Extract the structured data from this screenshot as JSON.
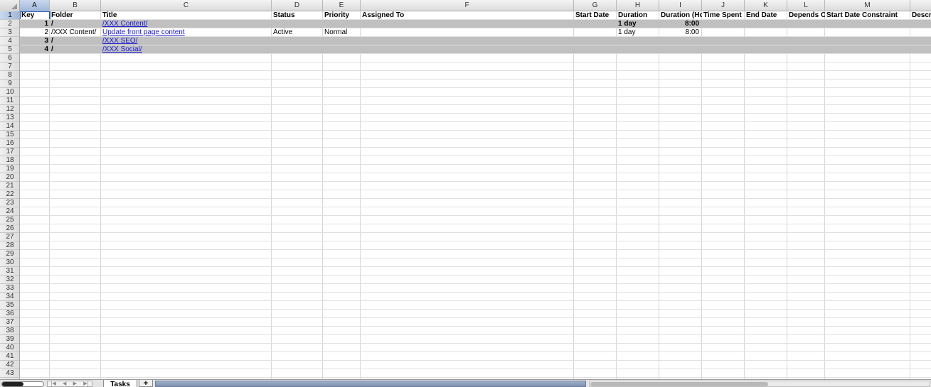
{
  "columns": [
    "A",
    "B",
    "C",
    "D",
    "E",
    "F",
    "G",
    "H",
    "I",
    "J",
    "K",
    "L",
    "M"
  ],
  "selected_column": "A",
  "rows": [
    "1",
    "2",
    "3",
    "4",
    "5",
    "6",
    "7",
    "8",
    "9",
    "10",
    "11",
    "12",
    "13",
    "14",
    "15",
    "16",
    "17",
    "18",
    "19",
    "20",
    "21",
    "22",
    "23",
    "24",
    "25",
    "26",
    "27",
    "28",
    "29",
    "30",
    "31",
    "32",
    "33",
    "34",
    "35",
    "36",
    "37",
    "38",
    "39",
    "40",
    "41",
    "42",
    "43"
  ],
  "selected_row": "1",
  "header_row": {
    "key": "Key",
    "folder": "Folder",
    "title": "Title",
    "status": "Status",
    "priority": "Priority",
    "assigned_to": "Assigned To",
    "start_date": "Start Date",
    "duration": "Duration",
    "duration_hours": "Duration (Ho",
    "time_spent": "Time Spent",
    "end_date": "End Date",
    "depends_on": "Depends O",
    "start_date_constraint": "Start Date Constraint",
    "description": "Descri"
  },
  "data_rows": [
    {
      "key": "1",
      "folder": "/",
      "title": "/XXX Content/",
      "status": "",
      "priority": "",
      "duration": "1 day",
      "duration_hours": "8:00",
      "grey": true
    },
    {
      "key": "2",
      "folder": "/XXX Content/",
      "title": "Update front page content",
      "status": "Active",
      "priority": "Normal",
      "duration": "1 day",
      "duration_hours": "8:00",
      "grey": false
    },
    {
      "key": "3",
      "folder": "/",
      "title": "/XXX SEO/",
      "status": "",
      "priority": "",
      "duration": "",
      "duration_hours": "",
      "grey": true
    },
    {
      "key": "4",
      "folder": "/",
      "title": "/XXX Social/",
      "status": "",
      "priority": "",
      "duration": "",
      "duration_hours": "",
      "grey": true
    }
  ],
  "sheet_tabs": {
    "active": "Tasks",
    "add_label": "+"
  },
  "nav_arrows": [
    "|◀",
    "◀",
    "▶",
    "▶|"
  ],
  "colors": {
    "group_row": "#c0c0c0",
    "link": "#1a1ad6",
    "selection": "#2a5fb0"
  }
}
